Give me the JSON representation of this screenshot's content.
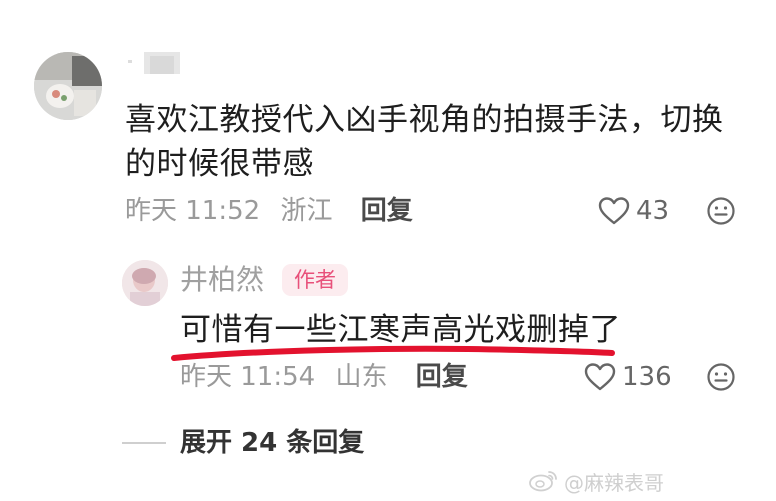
{
  "comment": {
    "username": "",
    "text": "喜欢江教授代入凶手视角的拍摄手法，切换的时候很带感",
    "time": "昨天 11:52",
    "location": "浙江",
    "reply_label": "回复",
    "likes": "43"
  },
  "author_reply": {
    "name": "井柏然",
    "badge": "作者",
    "text": "可惜有一些江寒声高光戏删掉了",
    "time": "昨天 11:54",
    "location": "山东",
    "reply_label": "回复",
    "likes": "136"
  },
  "expand_replies": "展开 24 条回复",
  "watermark": {
    "handle": "@麻辣表哥"
  },
  "colors": {
    "badge_bg": "#fcecef",
    "badge_text": "#e8507a",
    "highlight_underline": "#e3122e"
  },
  "icons": [
    "heart-outline-icon",
    "emoji-face-icon",
    "weibo-logo-icon"
  ]
}
